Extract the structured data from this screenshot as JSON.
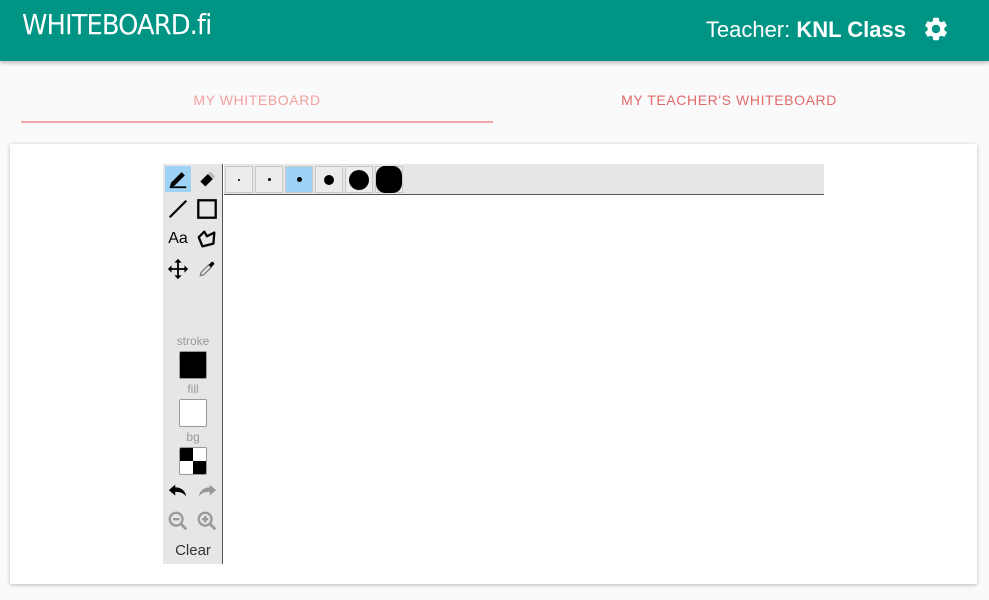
{
  "header": {
    "logo": "WHITEBOARD.fi",
    "teacher_prefix": "Teacher: ",
    "class_name": "KNL Class"
  },
  "tabs": [
    {
      "label": "MY WHITEBOARD",
      "active": true
    },
    {
      "label": "MY TEACHER'S WHITEBOARD",
      "active": false
    }
  ],
  "toolbar": {
    "text_tool_label": "Aa",
    "stroke_label": "stroke",
    "fill_label": "fill",
    "bg_label": "bg",
    "clear_label": "Clear",
    "stroke_color": "#000000",
    "fill_color": "#ffffff"
  },
  "brush_sizes": {
    "selected_index": 2,
    "count": 6
  },
  "colors": {
    "appbar": "#009485",
    "tab_active": "#f3a0a0",
    "tab_inactive": "#e16b6b",
    "selected_tool": "#9fd3f5"
  }
}
